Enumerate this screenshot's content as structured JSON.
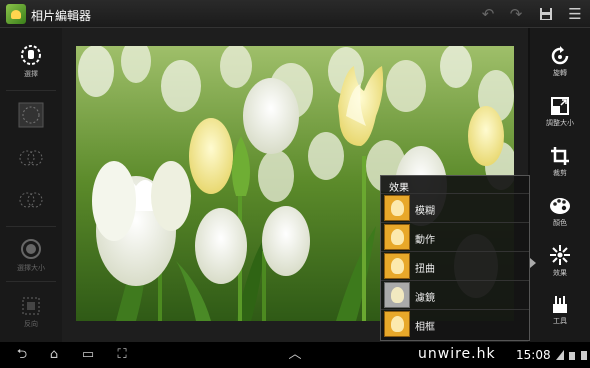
{
  "app": {
    "title": "相片編輯器"
  },
  "left_tools": [
    {
      "label": "選擇"
    },
    {
      "label": "選擇大小"
    },
    {
      "label": "反向"
    }
  ],
  "right_tools": [
    {
      "label": "旋轉",
      "icon": "rotate-icon"
    },
    {
      "label": "調整大小",
      "icon": "resize-icon"
    },
    {
      "label": "裁剪",
      "icon": "crop-icon"
    },
    {
      "label": "顏色",
      "icon": "palette-icon"
    },
    {
      "label": "效果",
      "icon": "effects-icon"
    },
    {
      "label": "工具",
      "icon": "tools-icon"
    }
  ],
  "effects_popup": {
    "title": "效果",
    "items": [
      {
        "label": "模糊"
      },
      {
        "label": "動作"
      },
      {
        "label": "扭曲"
      },
      {
        "label": "濾鏡"
      },
      {
        "label": "相框"
      }
    ]
  },
  "statusbar": {
    "watermark": "unwire.hk",
    "time": "15:08"
  },
  "colors": {
    "accent": "#e8a82a",
    "toolbar_bg": "#191919",
    "title_bar": "#1b1b1b"
  }
}
